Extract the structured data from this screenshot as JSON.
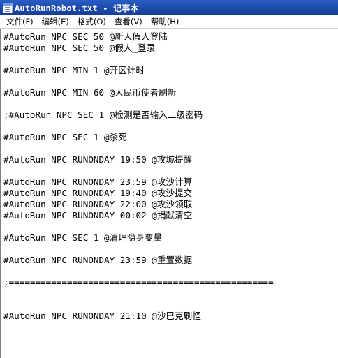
{
  "window": {
    "title": "AutoRunRobot.txt - 记事本",
    "icon": "notepad-icon"
  },
  "menu": [
    {
      "label": "文件(F)"
    },
    {
      "label": "编辑(E)"
    },
    {
      "label": "格式(O)"
    },
    {
      "label": "查看(V)"
    },
    {
      "label": "帮助(H)"
    }
  ],
  "editor": {
    "lines": [
      "#AutoRun NPC SEC 50 @新人假人登陆",
      "#AutoRun NPC SEC 50 @假人_登录",
      "#AutoRun NPC MIN 1 @开区计时",
      "#AutoRun NPC MIN 60 @人民币使者刷新",
      ";#AutoRun NPC SEC 1 @检测是否输入二级密码",
      "#AutoRun NPC SEC 1 @杀死",
      "#AutoRun NPC RUNONDAY 19:50 @攻城提醒",
      "#AutoRun NPC RUNONDAY 23:59 @攻沙计算",
      "#AutoRun NPC RUNONDAY 19:40 @攻沙提交",
      "#AutoRun NPC RUNONDAY 22:00 @攻沙领取",
      "#AutoRun NPC RUNONDAY 00:02 @捐献清空",
      "#AutoRun NPC SEC 1 @清理隐身变量",
      "#AutoRun NPC RUNONDAY 23:59 @重置数据",
      ";==================================================",
      "#AutoRun NPC RUNONDAY 21:10 @沙巴克刷怪"
    ]
  }
}
